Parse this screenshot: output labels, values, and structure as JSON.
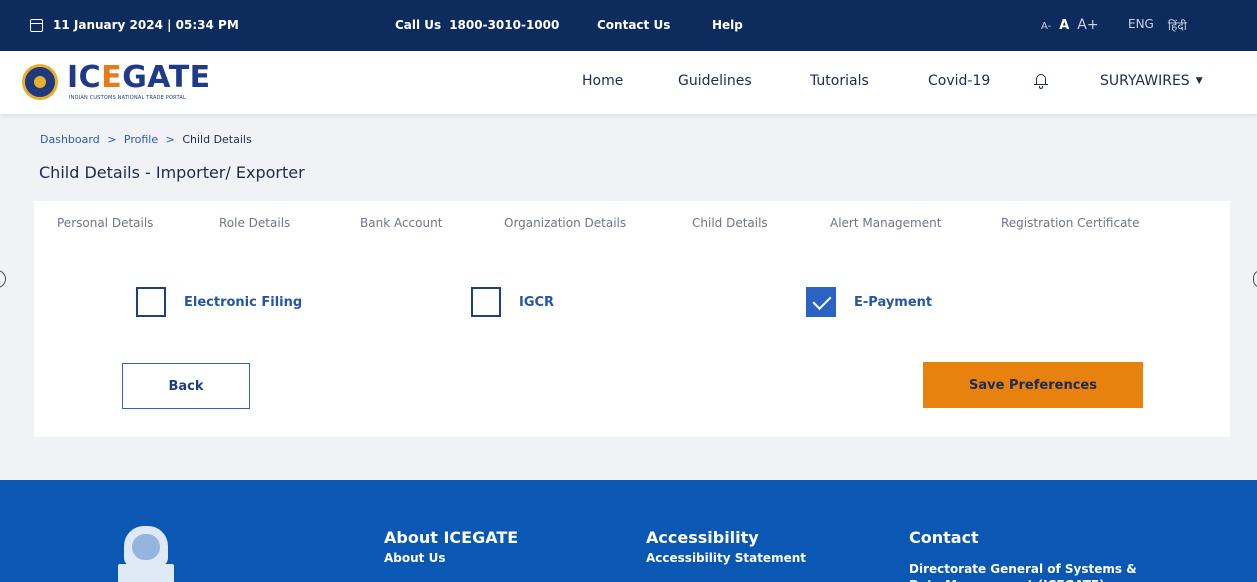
{
  "topbar": {
    "date_time": "11 January 2024 | 05:34 PM",
    "call_label": "Call Us",
    "call_number": "1800-3010-1000",
    "contact": "Contact Us",
    "help": "Help",
    "font_small": "A-",
    "font_normal": "A",
    "font_large": "A+",
    "lang_en": "ENG",
    "lang_hi": "हिंदी"
  },
  "header": {
    "logo_text_a": "IC",
    "logo_text_b": "E",
    "logo_text_c": "GATE",
    "logo_tagline": "INDIAN CUSTOMS NATIONAL TRADE PORTAL",
    "nav": [
      "Home",
      "Guidelines",
      "Tutorials",
      "Covid-19"
    ],
    "user": "SURYAWIRES"
  },
  "breadcrumb": {
    "items": [
      "Dashboard",
      "Profile",
      "Child Details"
    ],
    "separator": ">"
  },
  "page_title": "Child Details - Importer/ Exporter",
  "tabs": [
    "Personal Details",
    "Role Details",
    "Bank Account",
    "Organization Details",
    "Child Details",
    "Alert Management",
    "Registration Certificate"
  ],
  "options": [
    {
      "label": "Electronic Filing",
      "checked": false
    },
    {
      "label": "IGCR",
      "checked": false
    },
    {
      "label": "E-Payment",
      "checked": true
    }
  ],
  "buttons": {
    "back": "Back",
    "save": "Save Preferences"
  },
  "footer": {
    "col1_heading": "About ICEGATE",
    "col1_link": "About Us",
    "col2_heading": "Accessibility",
    "col2_link": "Accessibility Statement",
    "col3_heading": "Contact",
    "col3_line": "Directorate General of Systems & Data Management (ICEGATE)"
  },
  "colors": {
    "topbar_bg": "#0d2b5c",
    "footer_bg": "#0b57b4",
    "save_button_bg": "#e8820e",
    "checkbox_checked": "#2b63c4",
    "link": "#2a5ab3"
  }
}
